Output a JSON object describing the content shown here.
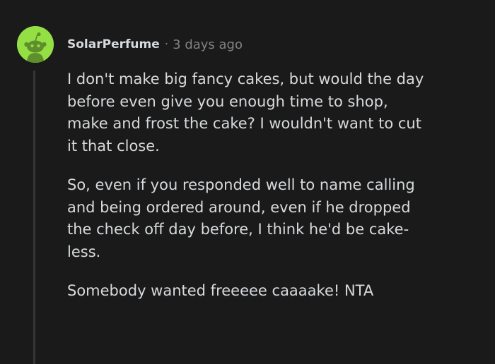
{
  "comment": {
    "author": "SolarPerfume",
    "separator": "·",
    "timestamp": "3 days ago",
    "avatar_icon": "reddit-snoo-avatar-icon",
    "avatar_color": "#94e044",
    "paragraphs": [
      "I don't make big fancy cakes, but would the day\nbefore even give you enough time to shop,\nmake and frost the cake? I wouldn't want to cut\nit that close.",
      "So, even if you responded well to name calling\nand being ordered around, even if he dropped\nthe check off day before, I think he'd be cake-\nless.",
      "Somebody wanted freeeee caaaake! NTA"
    ]
  },
  "colors": {
    "background": "#1a1a1b",
    "text": "#d7dadc",
    "muted": "#818384",
    "thread_line": "#343536"
  }
}
